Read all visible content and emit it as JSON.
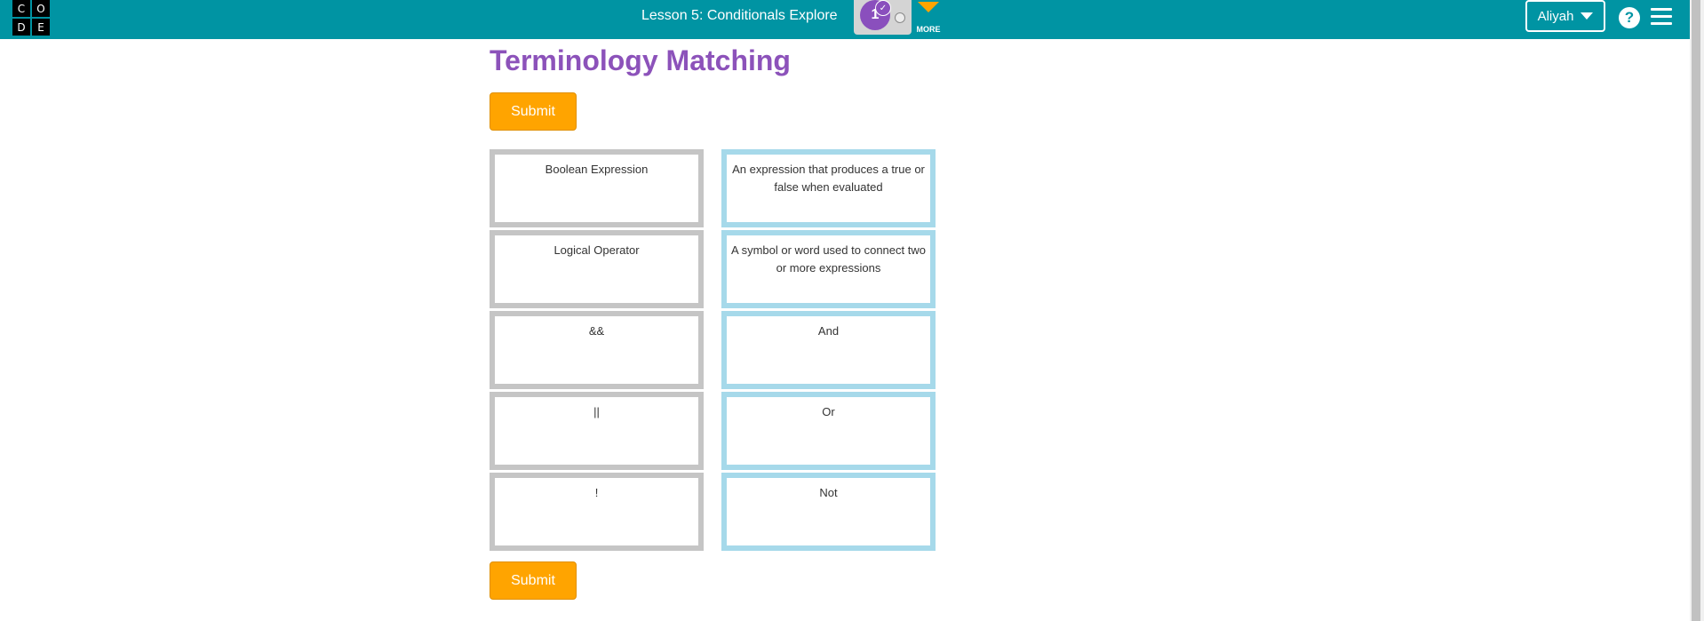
{
  "header": {
    "logo_letters": [
      "C",
      "O",
      "D",
      "E"
    ],
    "lesson_title": "Lesson 5: Conditionals Explore",
    "progress": {
      "level_number": "1",
      "check_symbol": "✓"
    },
    "more_label": "MORE",
    "user_name": "Aliyah",
    "help_symbol": "?"
  },
  "page": {
    "title": "Terminology Matching",
    "submit_label": "Submit"
  },
  "matching": {
    "terms": [
      "Boolean Expression",
      "Logical Operator",
      "&&",
      "||",
      "!"
    ],
    "definitions": [
      "An expression that produces a true or false when evaluated",
      "A symbol or word used to connect two or more expressions",
      "And",
      "Or",
      "Not"
    ]
  },
  "colors": {
    "header_bg": "#0094a3",
    "title": "#8c52ba",
    "submit_bg": "#ffa400",
    "term_border": "#c5c5c5",
    "definition_border": "#a6d9ea"
  },
  "icons": {
    "more": "chevron-down-icon",
    "user_menu": "caret-down-icon",
    "help": "question-icon",
    "menu": "hamburger-icon"
  }
}
